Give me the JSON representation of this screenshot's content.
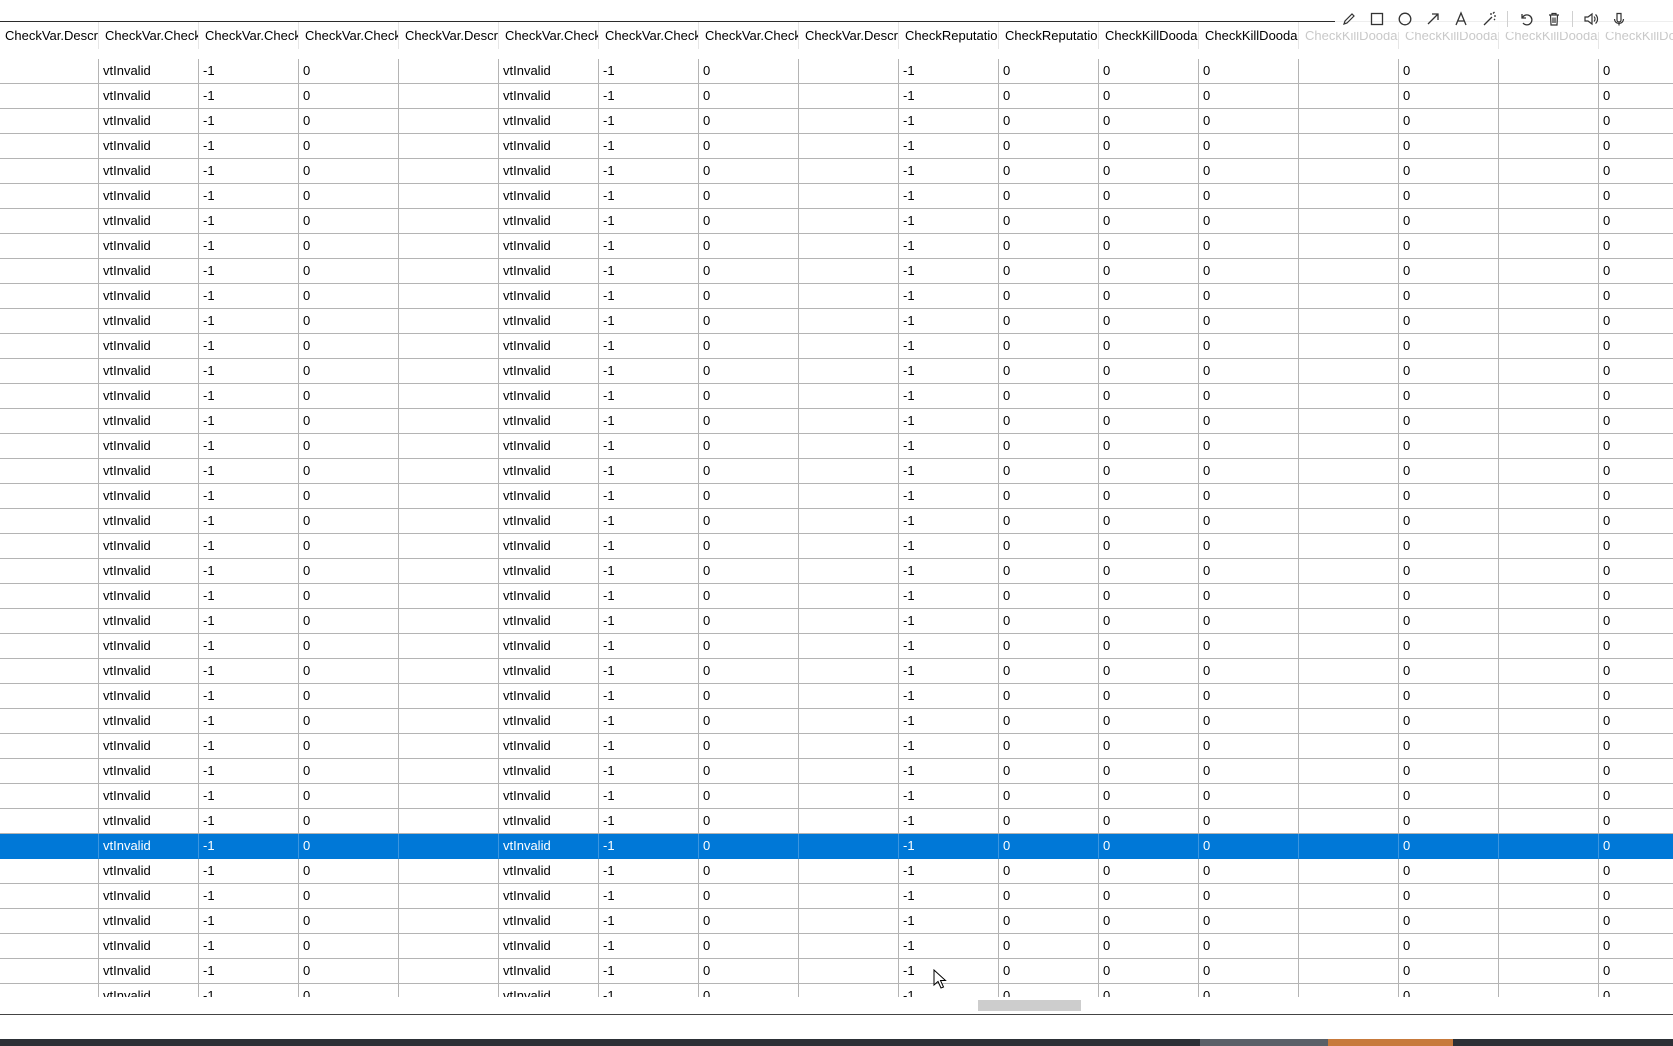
{
  "columns": [
    "CheckVar.Check",
    "CheckVar.Descr",
    "CheckVar.Check",
    "CheckVar.Check",
    "CheckVar.Check",
    "CheckVar.Descr",
    "CheckVar.Check",
    "CheckVar.Check",
    "CheckVar.Check",
    "CheckVar.Descr",
    "CheckReputatio",
    "CheckReputatio",
    "CheckKillDooda",
    "CheckKillDooda",
    "CheckKillDooda",
    "CheckKillDooda",
    "CheckKillDooda",
    "CheckKillDooda"
  ],
  "row_values": [
    "",
    "",
    "vtInvalid",
    "-1",
    "0",
    "",
    "vtInvalid",
    "-1",
    "0",
    "",
    "-1",
    "0",
    "0",
    "0",
    "",
    "0",
    "",
    "0"
  ],
  "row_count": 38,
  "selected_row_index": 31,
  "toolbar": {
    "icons": [
      "pencil-icon",
      "rectangle-icon",
      "circle-icon",
      "arrow-icon",
      "text-icon",
      "magic-wand-icon",
      "undo-icon",
      "trash-icon",
      "speaker-icon",
      "microphone-icon"
    ]
  },
  "colors": {
    "selection": "#0078d7",
    "gridline": "#b4b4b4"
  }
}
